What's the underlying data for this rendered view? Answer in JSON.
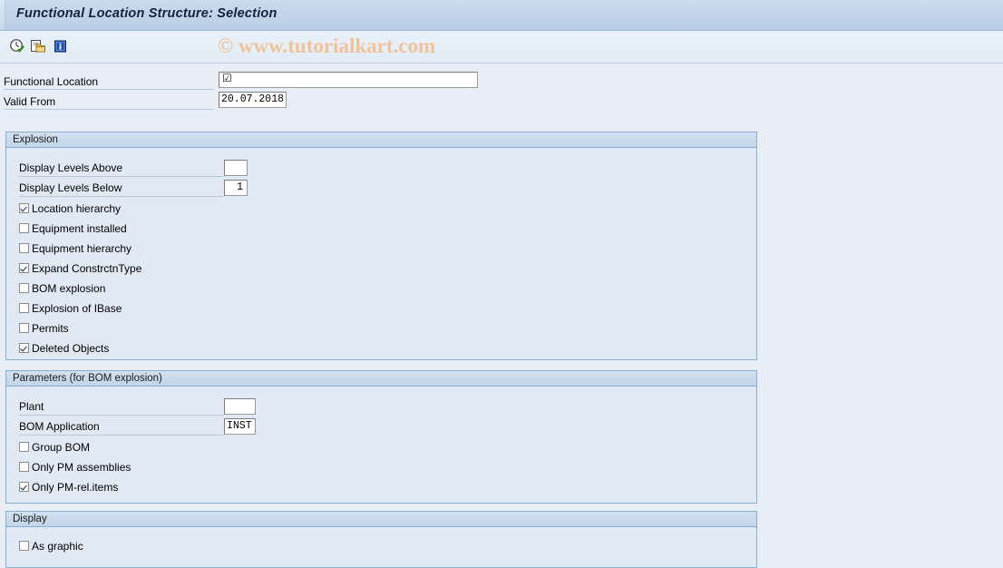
{
  "window": {
    "title": "Functional Location Structure: Selection"
  },
  "toolbar": {
    "items": [
      {
        "name": "execute-icon",
        "tooltip": "Execute"
      },
      {
        "name": "get-variant-icon",
        "tooltip": "Get Variant"
      },
      {
        "name": "info-icon",
        "tooltip": "Information"
      }
    ]
  },
  "watermark": {
    "text": "© www.tutorialkart.com",
    "color": "#f0c39a"
  },
  "selection": {
    "functional_location": {
      "label": "Functional Location",
      "value": "",
      "placeholder": "",
      "cursor_glyph": "☑"
    },
    "valid_from": {
      "label": "Valid From",
      "value": "20.07.2018",
      "placeholder": ""
    }
  },
  "explosion": {
    "title": "Explosion",
    "display_levels_above": {
      "label": "Display Levels Above",
      "value": ""
    },
    "display_levels_below": {
      "label": "Display Levels Below",
      "value": "1"
    },
    "checkboxes": [
      {
        "label": "Location hierarchy",
        "checked": true
      },
      {
        "label": "Equipment installed",
        "checked": false
      },
      {
        "label": "Equipment hierarchy",
        "checked": false
      },
      {
        "label": "Expand ConstrctnType",
        "checked": true
      },
      {
        "label": "BOM explosion",
        "checked": false
      },
      {
        "label": "Explosion of IBase",
        "checked": false
      },
      {
        "label": "Permits",
        "checked": false
      },
      {
        "label": "Deleted Objects",
        "checked": true
      }
    ]
  },
  "parameters": {
    "title": "Parameters (for BOM explosion)",
    "plant": {
      "label": "Plant",
      "value": ""
    },
    "bom_application": {
      "label": "BOM Application",
      "value": "INST"
    },
    "checkboxes": [
      {
        "label": "Group BOM",
        "checked": false
      },
      {
        "label": "Only PM assemblies",
        "checked": false
      },
      {
        "label": "Only PM-rel.items",
        "checked": true
      }
    ]
  },
  "display": {
    "title": "Display",
    "checkboxes": [
      {
        "label": "As graphic",
        "checked": false
      }
    ]
  },
  "theme": {
    "page_background": "#e8eef7",
    "titlebar_background": "#c3d5ea",
    "group_border": "#8aaed1",
    "group_background": "#e0e9f4",
    "check_color": "#1b2d4d"
  }
}
